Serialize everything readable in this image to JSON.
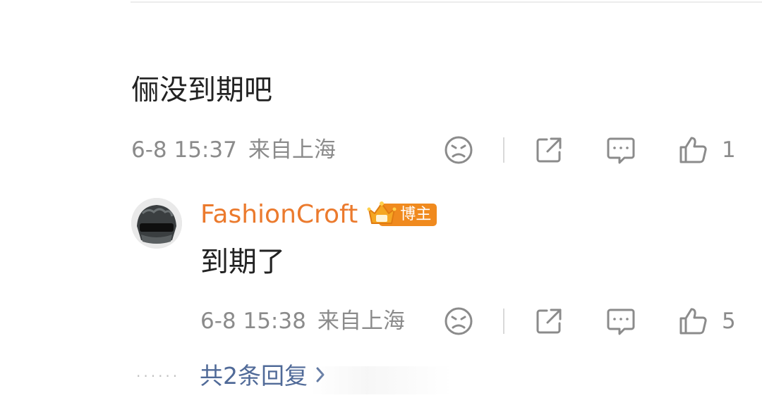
{
  "comment": {
    "text": "俪没到期吧",
    "date": "6-8 15:37",
    "location": "来自上海",
    "like_count": "1"
  },
  "reply": {
    "username": "FashionCroft",
    "badge_label": "博主",
    "text": "到期了",
    "date": "6-8 15:38",
    "location": "来自上海",
    "like_count": "5"
  },
  "more_replies": {
    "label": "共2条回复",
    "icon": "chevron-right-icon"
  },
  "icons": [
    "dislike-face-icon",
    "share-icon",
    "comment-icon",
    "thumbs-up-icon",
    "crown-icon"
  ],
  "colors": {
    "username": "#eb7a2d",
    "badge": "#f08a1e",
    "link": "#506a98",
    "meta": "#8b8b8b"
  }
}
